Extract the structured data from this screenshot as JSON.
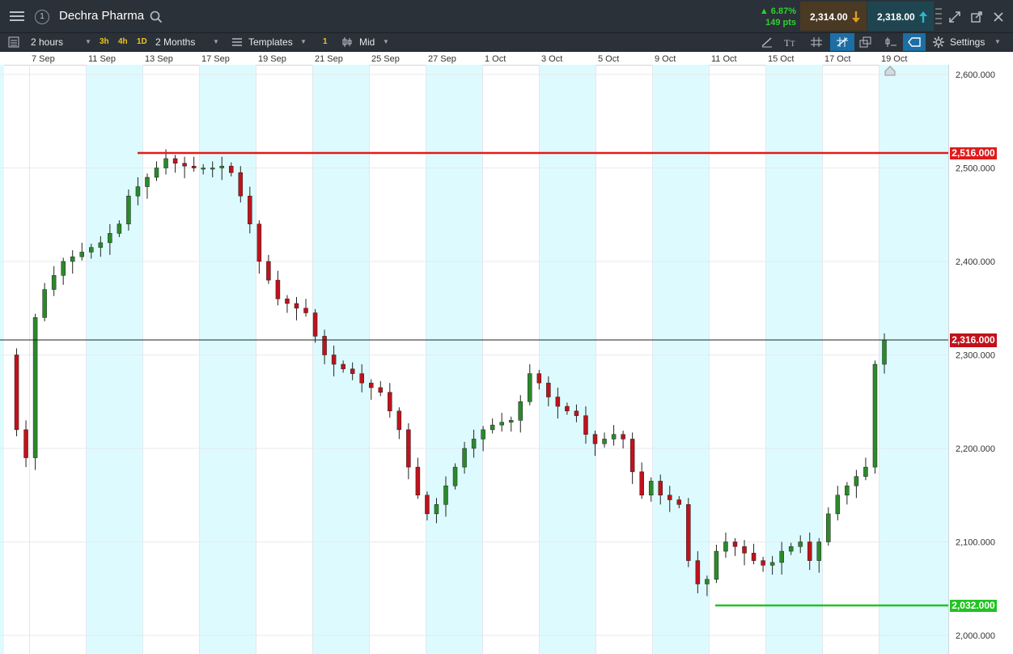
{
  "header": {
    "instrument_name": "Dechra Pharma",
    "window_number": "1",
    "change_percent": "▲ 6.87%",
    "change_points": "149 pts",
    "sell_price": "2,314.00",
    "buy_price": "2,318.00"
  },
  "toolbar": {
    "interval": "2 hours",
    "quick_intervals": [
      "3h",
      "4h",
      "1D"
    ],
    "range": "2 Months",
    "templates_label": "Templates",
    "badge_count": "1",
    "price_type": "Mid",
    "settings_label": "Settings"
  },
  "colors": {
    "up_candle": "#2a8a2a",
    "down_candle": "#c0121b",
    "resistance": "#e01b1b",
    "support": "#22c322",
    "current_price": "#c0121b",
    "shade": "#ddfbfe"
  },
  "icons": [
    "menu-icon",
    "search-icon",
    "arrow-down-icon",
    "arrow-up-icon",
    "expand-icon",
    "popout-icon",
    "close-icon",
    "list-icon",
    "gear-icon"
  ],
  "chart_data": {
    "type": "candlestick",
    "x_tick_labels": [
      "7 Sep",
      "11 Sep",
      "13 Sep",
      "17 Sep",
      "19 Sep",
      "21 Sep",
      "25 Sep",
      "27 Sep",
      "1 Oct",
      "3 Oct",
      "5 Oct",
      "9 Oct",
      "11 Oct",
      "15 Oct",
      "17 Oct",
      "19 Oct"
    ],
    "y_tick_labels": [
      "2,600.000",
      "2,500.000",
      "2,400.000",
      "2,300.000",
      "2,200.000",
      "2,100.000",
      "2,000.000"
    ],
    "y_ticks": [
      2600,
      2500,
      2400,
      2300,
      2200,
      2100,
      2000
    ],
    "ylim": [
      1985,
      2615
    ],
    "resistance_line": {
      "value": 2516,
      "label": "2,516.000"
    },
    "support_line": {
      "value": 2032,
      "label": "2,032.000"
    },
    "current_price": {
      "value": 2316,
      "label": "2,316.000"
    },
    "close_path": [
      [
        0,
        2300
      ],
      [
        1,
        2220
      ],
      [
        2,
        2190
      ],
      [
        3,
        2340
      ],
      [
        4,
        2370
      ],
      [
        5,
        2385
      ],
      [
        6,
        2400
      ],
      [
        7,
        2405
      ],
      [
        8,
        2410
      ],
      [
        9,
        2415
      ],
      [
        10,
        2420
      ],
      [
        11,
        2430
      ],
      [
        12,
        2440
      ],
      [
        13,
        2470
      ],
      [
        14,
        2480
      ],
      [
        15,
        2490
      ],
      [
        16,
        2500
      ],
      [
        17,
        2510
      ],
      [
        18,
        2505
      ],
      [
        19,
        2502
      ],
      [
        20,
        2500
      ],
      [
        21,
        2500
      ],
      [
        22,
        2500
      ],
      [
        23,
        2502
      ],
      [
        24,
        2495
      ],
      [
        25,
        2470
      ],
      [
        26,
        2440
      ],
      [
        27,
        2400
      ],
      [
        28,
        2380
      ],
      [
        29,
        2360
      ],
      [
        30,
        2355
      ],
      [
        31,
        2350
      ],
      [
        32,
        2345
      ],
      [
        33,
        2320
      ],
      [
        34,
        2300
      ],
      [
        35,
        2290
      ],
      [
        36,
        2285
      ],
      [
        37,
        2280
      ],
      [
        38,
        2270
      ],
      [
        39,
        2265
      ],
      [
        40,
        2260
      ],
      [
        41,
        2240
      ],
      [
        42,
        2220
      ],
      [
        43,
        2180
      ],
      [
        44,
        2150
      ],
      [
        45,
        2130
      ],
      [
        46,
        2140
      ],
      [
        47,
        2160
      ],
      [
        48,
        2180
      ],
      [
        49,
        2200
      ],
      [
        50,
        2210
      ],
      [
        51,
        2220
      ],
      [
        52,
        2225
      ],
      [
        53,
        2228
      ],
      [
        54,
        2230
      ],
      [
        55,
        2250
      ],
      [
        56,
        2280
      ],
      [
        57,
        2270
      ],
      [
        58,
        2255
      ],
      [
        59,
        2245
      ],
      [
        60,
        2240
      ],
      [
        61,
        2235
      ],
      [
        62,
        2215
      ],
      [
        63,
        2205
      ],
      [
        64,
        2210
      ],
      [
        65,
        2215
      ],
      [
        66,
        2210
      ],
      [
        67,
        2175
      ],
      [
        68,
        2150
      ],
      [
        69,
        2165
      ],
      [
        70,
        2150
      ],
      [
        71,
        2145
      ],
      [
        72,
        2140
      ],
      [
        73,
        2080
      ],
      [
        74,
        2055
      ],
      [
        75,
        2060
      ],
      [
        76,
        2090
      ],
      [
        77,
        2100
      ],
      [
        78,
        2095
      ],
      [
        79,
        2088
      ],
      [
        80,
        2080
      ],
      [
        81,
        2075
      ],
      [
        82,
        2078
      ],
      [
        83,
        2090
      ],
      [
        84,
        2095
      ],
      [
        85,
        2100
      ],
      [
        86,
        2080
      ],
      [
        87,
        2100
      ],
      [
        88,
        2130
      ],
      [
        89,
        2150
      ],
      [
        90,
        2160
      ],
      [
        91,
        2170
      ],
      [
        92,
        2180
      ],
      [
        93,
        2290
      ],
      [
        94,
        2316
      ]
    ]
  }
}
